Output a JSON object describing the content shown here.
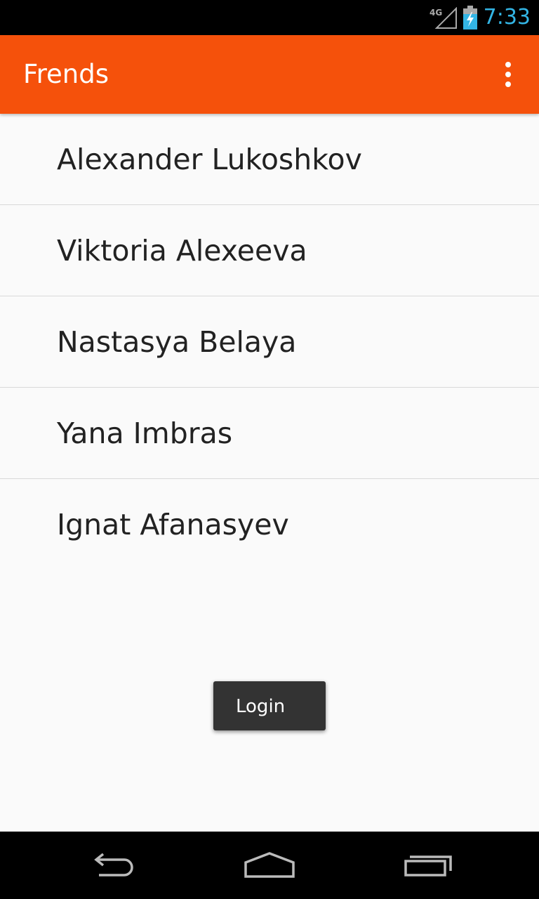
{
  "status_bar": {
    "network_label": "4G",
    "time": "7:33",
    "time_color": "#33b5e5",
    "icons": [
      "signal-4g-icon",
      "battery-charging-icon"
    ]
  },
  "action_bar": {
    "title": "Frends",
    "background_color": "#f5510b",
    "overflow_icon": "overflow-menu-icon"
  },
  "friends": [
    {
      "name": "Alexander Lukoshkov"
    },
    {
      "name": "Viktoria Alexeeva"
    },
    {
      "name": "Nastasya Belaya"
    },
    {
      "name": "Yana Imbras"
    },
    {
      "name": "Ignat Afanasyev"
    }
  ],
  "login_button": {
    "label": "Login"
  },
  "nav_bar": {
    "icons": [
      "back-icon",
      "home-icon",
      "recents-icon"
    ]
  }
}
